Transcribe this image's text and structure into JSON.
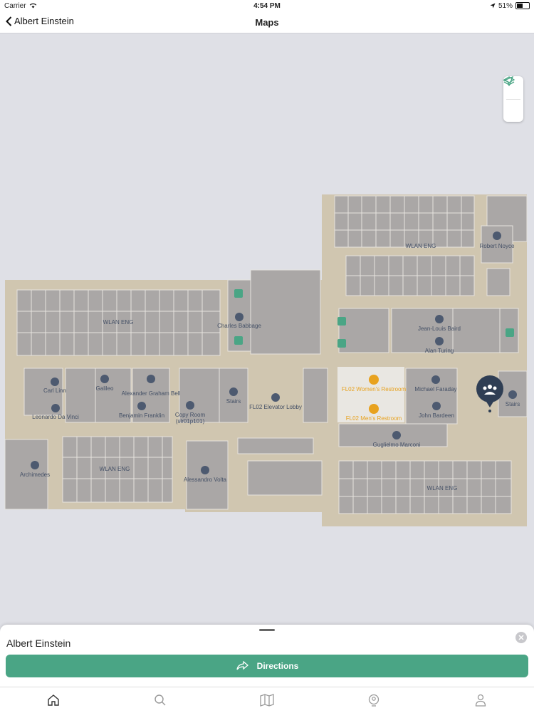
{
  "status": {
    "carrier": "Carrier",
    "time": "4:54 PM",
    "battery": "51%",
    "battery_level": 0.51
  },
  "nav": {
    "back_label": "Albert Einstein",
    "title": "Maps"
  },
  "map": {
    "zones": {
      "wlan1": "WLAN ENG",
      "wlan2": "WLAN ENG",
      "wlan3": "WLAN ENG",
      "wlan4": "WLAN ENG"
    },
    "rooms": {
      "robert_noyce": "Robert Noyce",
      "charles_babbage": "Charles Babbage",
      "jean_louis_baird": "Jean-Louis Baird",
      "alan_turing": "Alan Turing",
      "carl_linn": "Carl Linn",
      "galileo": "Galileo",
      "alexander_graham_bell": "Alexander Graham Bell",
      "leonardo_da_vinci": "Leonardo Da Vinci",
      "benjamin_franklin": "Benjamin Franklin",
      "copy_room": "Copy Room",
      "copy_room_code": "(slr01p101)",
      "stairs_left": "Stairs",
      "elevator_lobby": "FL02 Elevator Lobby",
      "womens_restroom": "FL02 Women's Restroom",
      "mens_restroom": "FL02 Men's Restroom",
      "michael_faraday": "Michael Faraday",
      "john_bardeen": "John Bardeen",
      "stairs_right": "Stairs",
      "guglielmo_marconi": "Guglielmo Marconi",
      "archimedes": "Archimedes",
      "alessandro_volta": "Alessandro Volta"
    }
  },
  "sheet": {
    "title": "Albert Einstein",
    "directions_label": "Directions"
  },
  "colors": {
    "accent": "#4aa585",
    "floor": "#d0c6b0",
    "room": "#aaa7a6",
    "restroom_label": "#e8a21e"
  }
}
